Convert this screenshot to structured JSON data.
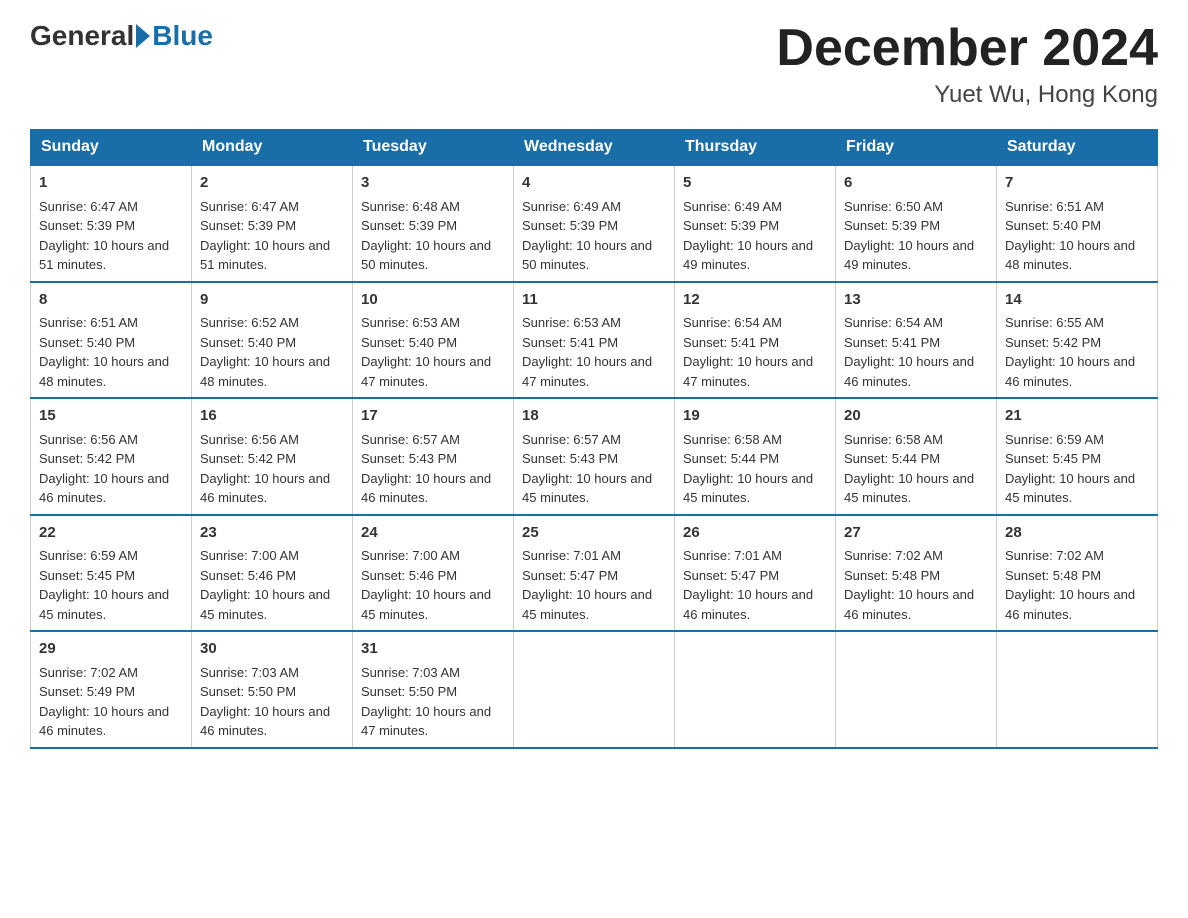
{
  "header": {
    "logo_general": "General",
    "logo_blue": "Blue",
    "month_title": "December 2024",
    "location": "Yuet Wu, Hong Kong"
  },
  "days_of_week": [
    "Sunday",
    "Monday",
    "Tuesday",
    "Wednesday",
    "Thursday",
    "Friday",
    "Saturday"
  ],
  "weeks": [
    [
      {
        "day": "1",
        "sunrise": "6:47 AM",
        "sunset": "5:39 PM",
        "daylight": "10 hours and 51 minutes."
      },
      {
        "day": "2",
        "sunrise": "6:47 AM",
        "sunset": "5:39 PM",
        "daylight": "10 hours and 51 minutes."
      },
      {
        "day": "3",
        "sunrise": "6:48 AM",
        "sunset": "5:39 PM",
        "daylight": "10 hours and 50 minutes."
      },
      {
        "day": "4",
        "sunrise": "6:49 AM",
        "sunset": "5:39 PM",
        "daylight": "10 hours and 50 minutes."
      },
      {
        "day": "5",
        "sunrise": "6:49 AM",
        "sunset": "5:39 PM",
        "daylight": "10 hours and 49 minutes."
      },
      {
        "day": "6",
        "sunrise": "6:50 AM",
        "sunset": "5:39 PM",
        "daylight": "10 hours and 49 minutes."
      },
      {
        "day": "7",
        "sunrise": "6:51 AM",
        "sunset": "5:40 PM",
        "daylight": "10 hours and 48 minutes."
      }
    ],
    [
      {
        "day": "8",
        "sunrise": "6:51 AM",
        "sunset": "5:40 PM",
        "daylight": "10 hours and 48 minutes."
      },
      {
        "day": "9",
        "sunrise": "6:52 AM",
        "sunset": "5:40 PM",
        "daylight": "10 hours and 48 minutes."
      },
      {
        "day": "10",
        "sunrise": "6:53 AM",
        "sunset": "5:40 PM",
        "daylight": "10 hours and 47 minutes."
      },
      {
        "day": "11",
        "sunrise": "6:53 AM",
        "sunset": "5:41 PM",
        "daylight": "10 hours and 47 minutes."
      },
      {
        "day": "12",
        "sunrise": "6:54 AM",
        "sunset": "5:41 PM",
        "daylight": "10 hours and 47 minutes."
      },
      {
        "day": "13",
        "sunrise": "6:54 AM",
        "sunset": "5:41 PM",
        "daylight": "10 hours and 46 minutes."
      },
      {
        "day": "14",
        "sunrise": "6:55 AM",
        "sunset": "5:42 PM",
        "daylight": "10 hours and 46 minutes."
      }
    ],
    [
      {
        "day": "15",
        "sunrise": "6:56 AM",
        "sunset": "5:42 PM",
        "daylight": "10 hours and 46 minutes."
      },
      {
        "day": "16",
        "sunrise": "6:56 AM",
        "sunset": "5:42 PM",
        "daylight": "10 hours and 46 minutes."
      },
      {
        "day": "17",
        "sunrise": "6:57 AM",
        "sunset": "5:43 PM",
        "daylight": "10 hours and 46 minutes."
      },
      {
        "day": "18",
        "sunrise": "6:57 AM",
        "sunset": "5:43 PM",
        "daylight": "10 hours and 45 minutes."
      },
      {
        "day": "19",
        "sunrise": "6:58 AM",
        "sunset": "5:44 PM",
        "daylight": "10 hours and 45 minutes."
      },
      {
        "day": "20",
        "sunrise": "6:58 AM",
        "sunset": "5:44 PM",
        "daylight": "10 hours and 45 minutes."
      },
      {
        "day": "21",
        "sunrise": "6:59 AM",
        "sunset": "5:45 PM",
        "daylight": "10 hours and 45 minutes."
      }
    ],
    [
      {
        "day": "22",
        "sunrise": "6:59 AM",
        "sunset": "5:45 PM",
        "daylight": "10 hours and 45 minutes."
      },
      {
        "day": "23",
        "sunrise": "7:00 AM",
        "sunset": "5:46 PM",
        "daylight": "10 hours and 45 minutes."
      },
      {
        "day": "24",
        "sunrise": "7:00 AM",
        "sunset": "5:46 PM",
        "daylight": "10 hours and 45 minutes."
      },
      {
        "day": "25",
        "sunrise": "7:01 AM",
        "sunset": "5:47 PM",
        "daylight": "10 hours and 45 minutes."
      },
      {
        "day": "26",
        "sunrise": "7:01 AM",
        "sunset": "5:47 PM",
        "daylight": "10 hours and 46 minutes."
      },
      {
        "day": "27",
        "sunrise": "7:02 AM",
        "sunset": "5:48 PM",
        "daylight": "10 hours and 46 minutes."
      },
      {
        "day": "28",
        "sunrise": "7:02 AM",
        "sunset": "5:48 PM",
        "daylight": "10 hours and 46 minutes."
      }
    ],
    [
      {
        "day": "29",
        "sunrise": "7:02 AM",
        "sunset": "5:49 PM",
        "daylight": "10 hours and 46 minutes."
      },
      {
        "day": "30",
        "sunrise": "7:03 AM",
        "sunset": "5:50 PM",
        "daylight": "10 hours and 46 minutes."
      },
      {
        "day": "31",
        "sunrise": "7:03 AM",
        "sunset": "5:50 PM",
        "daylight": "10 hours and 47 minutes."
      },
      null,
      null,
      null,
      null
    ]
  ],
  "labels": {
    "sunrise_prefix": "Sunrise: ",
    "sunset_prefix": "Sunset: ",
    "daylight_prefix": "Daylight: "
  }
}
